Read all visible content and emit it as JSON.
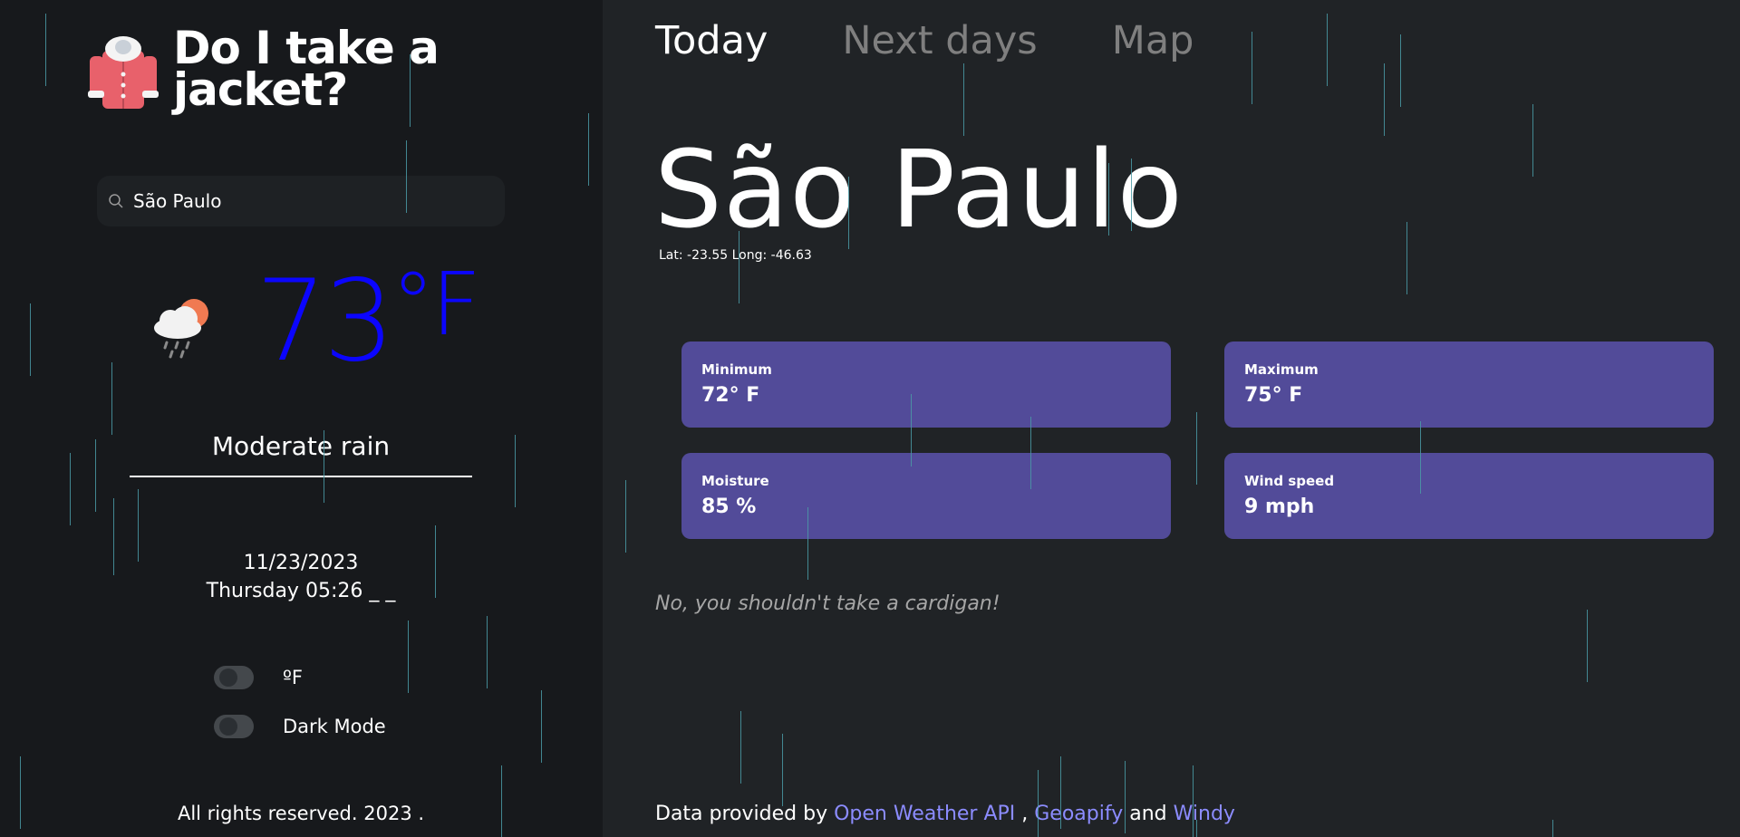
{
  "brand": {
    "title": "Do I take a jacket?"
  },
  "search": {
    "value": "São Paulo"
  },
  "current": {
    "temp_value": "73",
    "temp_unit": "°F",
    "description": "Moderate rain",
    "date": "11/23/2023",
    "time": "Thursday 05:26 _ _"
  },
  "settings": {
    "unit_label": "ºF",
    "dark_mode_label": "Dark Mode"
  },
  "footer_left": {
    "copyright": "All rights reserved. 2023 ."
  },
  "tabs": [
    {
      "label": "Today"
    },
    {
      "label": "Next days"
    },
    {
      "label": "Map"
    }
  ],
  "city": {
    "name": "São Paulo",
    "coords": "Lat: -23.55 Long: -46.63"
  },
  "stats": [
    {
      "label": "Minimum",
      "value": "72° F"
    },
    {
      "label": "Maximum",
      "value": "75° F"
    },
    {
      "label": "Moisture",
      "value": "85 %"
    },
    {
      "label": "Wind speed",
      "value": "9 mph"
    }
  ],
  "advice": "No, you shouldn't take a cardigan!",
  "credits": {
    "prefix": "Data provided by ",
    "link1": "Open Weather API",
    "sep1": " , ",
    "link2": "Geoapify",
    "sep2": " and ",
    "link3": "Windy"
  },
  "colors": {
    "sidebar_bg": "#17191c",
    "main_bg": "#202326",
    "card_bg": "#524b99",
    "temp_color": "#0b05ff",
    "link_color": "#8c8cff",
    "rain_color": "#4a9aa6"
  }
}
